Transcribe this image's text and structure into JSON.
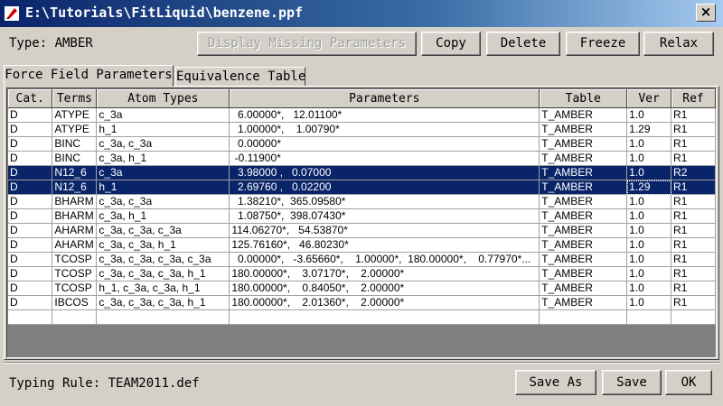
{
  "window": {
    "title": "E:\\Tutorials\\FitLiquid\\benzene.ppf",
    "close_label": "×"
  },
  "header": {
    "type_label": "Type: AMBER",
    "buttons": {
      "missing": "Display Missing Parameters",
      "copy": "Copy",
      "delete": "Delete",
      "freeze": "Freeze",
      "relax": "Relax"
    }
  },
  "tabs": [
    {
      "label": "Force Field Parameters",
      "active": true
    },
    {
      "label": "Equivalence Table",
      "active": false
    }
  ],
  "table": {
    "columns": [
      "Cat.",
      "Terms",
      "Atom Types",
      "Parameters",
      "Table",
      "Ver",
      "Ref"
    ],
    "rows": [
      [
        "D",
        "ATYPE",
        "c_3a",
        "  6.00000*,   12.01100*",
        "T_AMBER",
        "1.0",
        "R1"
      ],
      [
        "D",
        "ATYPE",
        "h_1",
        "  1.00000*,    1.00790*",
        "T_AMBER",
        "1.29",
        "R1"
      ],
      [
        "D",
        "BINC",
        "c_3a, c_3a",
        "  0.00000*",
        "T_AMBER",
        "1.0",
        "R1"
      ],
      [
        "D",
        "BINC",
        "c_3a, h_1",
        " -0.11900*",
        "T_AMBER",
        "1.0",
        "R1"
      ],
      [
        "D",
        "N12_6",
        "c_3a",
        "  3.98000 ,   0.07000",
        "T_AMBER",
        "1.0",
        "R2"
      ],
      [
        "D",
        "N12_6",
        "h_1",
        "  2.69760 ,   0.02200",
        "T_AMBER",
        "1.29",
        "R1"
      ],
      [
        "D",
        "BHARM",
        "c_3a, c_3a",
        "  1.38210*,  365.09580*",
        "T_AMBER",
        "1.0",
        "R1"
      ],
      [
        "D",
        "BHARM",
        "c_3a, h_1",
        "  1.08750*,  398.07430*",
        "T_AMBER",
        "1.0",
        "R1"
      ],
      [
        "D",
        "AHARM",
        "c_3a, c_3a, c_3a",
        "114.06270*,   54.53870*",
        "T_AMBER",
        "1.0",
        "R1"
      ],
      [
        "D",
        "AHARM",
        "c_3a, c_3a, h_1",
        "125.76160*,   46.80230*",
        "T_AMBER",
        "1.0",
        "R1"
      ],
      [
        "D",
        "TCOSP",
        "c_3a, c_3a, c_3a, c_3a",
        "  0.00000*,   -3.65660*,    1.00000*,  180.00000*,    0.77970*...",
        "T_AMBER",
        "1.0",
        "R1"
      ],
      [
        "D",
        "TCOSP",
        "c_3a, c_3a, c_3a, h_1",
        "180.00000*,    3.07170*,    2.00000*",
        "T_AMBER",
        "1.0",
        "R1"
      ],
      [
        "D",
        "TCOSP",
        "h_1, c_3a, c_3a, h_1",
        "180.00000*,    0.84050*,    2.00000*",
        "T_AMBER",
        "1.0",
        "R1"
      ],
      [
        "D",
        "IBCOS",
        "c_3a, c_3a, c_3a, h_1",
        "180.00000*,    2.01360*,    2.00000*",
        "T_AMBER",
        "1.0",
        "R1"
      ]
    ],
    "selected_rows": [
      4,
      5
    ]
  },
  "footer": {
    "typing_rule": "Typing Rule: TEAM2011.def",
    "buttons": {
      "save_as": "Save As",
      "save": "Save",
      "ok": "OK"
    }
  },
  "colors": {
    "title_bar": "#0a246a",
    "selection": "#0a246a",
    "face": "#d4d0c8"
  }
}
